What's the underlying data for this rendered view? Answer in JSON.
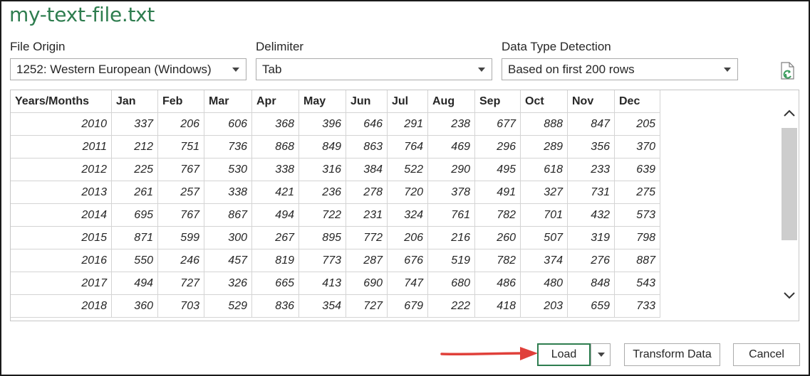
{
  "window": {
    "title": "my-text-file.txt"
  },
  "options": {
    "file_origin": {
      "label": "File Origin",
      "value": "1252: Western European (Windows)"
    },
    "delimiter": {
      "label": "Delimiter",
      "value": "Tab"
    },
    "detection": {
      "label": "Data Type Detection",
      "value": "Based on first 200 rows"
    }
  },
  "grid": {
    "headers": [
      "Years/Months",
      "Jan",
      "Feb",
      "Mar",
      "Apr",
      "May",
      "Jun",
      "Jul",
      "Aug",
      "Sep",
      "Oct",
      "Nov",
      "Dec"
    ],
    "rows": [
      [
        "2010",
        "337",
        "206",
        "606",
        "368",
        "396",
        "646",
        "291",
        "238",
        "677",
        "888",
        "847",
        "205"
      ],
      [
        "2011",
        "212",
        "751",
        "736",
        "868",
        "849",
        "863",
        "764",
        "469",
        "296",
        "289",
        "356",
        "370"
      ],
      [
        "2012",
        "225",
        "767",
        "530",
        "338",
        "316",
        "384",
        "522",
        "290",
        "495",
        "618",
        "233",
        "639"
      ],
      [
        "2013",
        "261",
        "257",
        "338",
        "421",
        "236",
        "278",
        "720",
        "378",
        "491",
        "327",
        "731",
        "275"
      ],
      [
        "2014",
        "695",
        "767",
        "867",
        "494",
        "722",
        "231",
        "324",
        "761",
        "782",
        "701",
        "432",
        "573"
      ],
      [
        "2015",
        "871",
        "599",
        "300",
        "267",
        "895",
        "772",
        "206",
        "216",
        "260",
        "507",
        "319",
        "798"
      ],
      [
        "2016",
        "550",
        "246",
        "457",
        "819",
        "773",
        "287",
        "676",
        "519",
        "782",
        "374",
        "276",
        "887"
      ],
      [
        "2017",
        "494",
        "727",
        "326",
        "665",
        "413",
        "690",
        "747",
        "680",
        "486",
        "480",
        "848",
        "543"
      ],
      [
        "2018",
        "360",
        "703",
        "529",
        "836",
        "354",
        "727",
        "679",
        "222",
        "418",
        "203",
        "659",
        "733"
      ]
    ]
  },
  "buttons": {
    "load": "Load",
    "transform": "Transform Data",
    "cancel": "Cancel"
  },
  "colors": {
    "accent": "#2e7d4f",
    "arrow": "#e0403a",
    "refresh_icon": "#3a9b5c"
  },
  "icons": {
    "refresh": "refresh-icon",
    "dropdown": "chevron-down-icon",
    "scroll_up": "chevron-up-icon",
    "scroll_down": "chevron-down-icon"
  }
}
